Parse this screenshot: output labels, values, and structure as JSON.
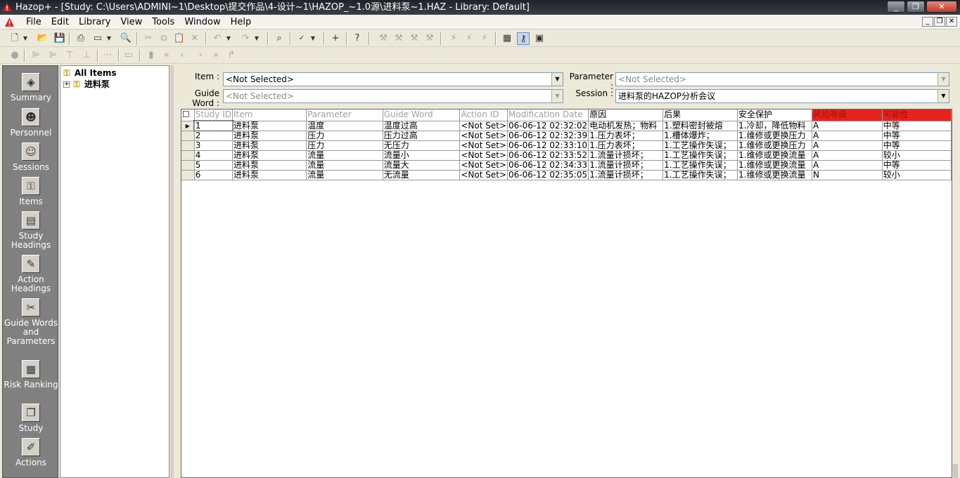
{
  "window": {
    "title": "Hazop+ - [Study: C:\\Users\\ADMINI~1\\Desktop\\提交作品\\4-设计~1\\HAZOP_~1.0源\\进料泵~1.HAZ - Library: Default]"
  },
  "menu": [
    "File",
    "Edit",
    "Library",
    "View",
    "Tools",
    "Window",
    "Help"
  ],
  "sidebar": [
    {
      "label": "Summary",
      "icon": "summary-icon",
      "glyph": "◈"
    },
    {
      "label": "Personnel",
      "icon": "person-icon",
      "glyph": "☻"
    },
    {
      "label": "Sessions",
      "icon": "sessions-icon",
      "glyph": "☺"
    },
    {
      "label": "Items",
      "icon": "key-icon",
      "glyph": "⚿"
    },
    {
      "label": "Study Headings",
      "icon": "headings-icon",
      "glyph": "▤"
    },
    {
      "label": "Action Headings",
      "icon": "action-headings-icon",
      "glyph": "✎"
    },
    {
      "label": "Guide Words and Parameters",
      "icon": "guide-words-icon",
      "glyph": "✂"
    },
    {
      "label": "Risk Ranking",
      "icon": "risk-ranking-icon",
      "glyph": "▦"
    },
    {
      "label": "Study",
      "icon": "book-icon",
      "glyph": "❐"
    },
    {
      "label": "Actions",
      "icon": "pencil-icon",
      "glyph": "✐"
    }
  ],
  "tree": {
    "root": "All Items",
    "child": "进料泵"
  },
  "filters": {
    "item_label": "Item :",
    "item_value": "<Not Selected>",
    "guide_label": "Guide Word :",
    "guide_value": "<Not Selected>",
    "param_label": "Parameter :",
    "param_value": "<Not Selected>",
    "session_label": "Session :",
    "session_value": "进料泵的HAZOP分析会议"
  },
  "table": {
    "columns": [
      "Study ID",
      "Item",
      "Parameter",
      "Guide Word",
      "Action ID",
      "Modification Date",
      "原因",
      "后果",
      "安全保护",
      "风险等级",
      "可能性"
    ],
    "rows": [
      [
        "1",
        "进料泵",
        "温度",
        "温度过高",
        "<Not Set>",
        "06-06-12 02:32:02",
        "电动机发热；物料",
        "1.塑料密封被熔",
        "1.冷却，降低物料",
        "A",
        "中等"
      ],
      [
        "2",
        "进料泵",
        "压力",
        "压力过高",
        "<Not Set>",
        "06-06-12 02:32:39",
        "1.压力表坏；",
        "1.槽体爆炸；",
        "1.维修或更换压力",
        "A",
        "中等"
      ],
      [
        "3",
        "进料泵",
        "压力",
        "无压力",
        "<Not Set>",
        "06-06-12 02:33:10",
        "1.压力表坏；",
        "1.工艺操作失误；",
        "1.维修或更换压力",
        "A",
        "中等"
      ],
      [
        "4",
        "进料泵",
        "流量",
        "流量小",
        "<Not Set>",
        "06-06-12 02:33:52",
        "1.流量计损坏；",
        "1.工艺操作失误；",
        "1.维修或更换流量",
        "A",
        "较小"
      ],
      [
        "5",
        "进料泵",
        "流量",
        "流量大",
        "<Not Set>",
        "06-06-12 02:34:33",
        "1.流量计损坏；",
        "1.工艺操作失误；",
        "1.维修或更换流量",
        "A",
        "中等"
      ],
      [
        "6",
        "进料泵",
        "流量",
        "无流量",
        "<Not Set>",
        "06-06-12 02:35:05",
        "1.流量计损坏；",
        "1.工艺操作失误；",
        "1.维修或更换流量",
        "N",
        "较小"
      ]
    ]
  }
}
